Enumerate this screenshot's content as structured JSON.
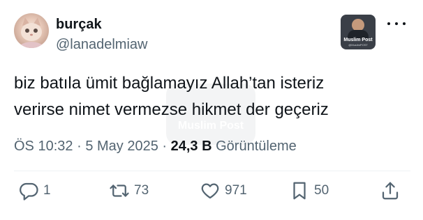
{
  "author": {
    "display_name": "burçak",
    "handle": "@lanadelmiaw",
    "avatar_icon": "cat-avatar"
  },
  "overlay": {
    "brand": "Muslim Post",
    "sub": "@MuslimPOST"
  },
  "watermark": {
    "text": "Muslim Post"
  },
  "tweet": {
    "lines": [
      "biz batıla ümit bağlamayız Allah’tan isteriz",
      "verirse nimet vermezse hikmet der geçeriz"
    ]
  },
  "meta": {
    "time": "ÖS 10:32",
    "separator": "·",
    "date": "5 May 2025",
    "views_count": "24,3 B",
    "views_label": "Görüntüleme"
  },
  "actions": {
    "replies": "1",
    "retweets": "73",
    "likes": "971",
    "bookmarks": "50"
  },
  "colors": {
    "text": "#0f1419",
    "secondary": "#536471",
    "divider": "#eff3f4"
  }
}
